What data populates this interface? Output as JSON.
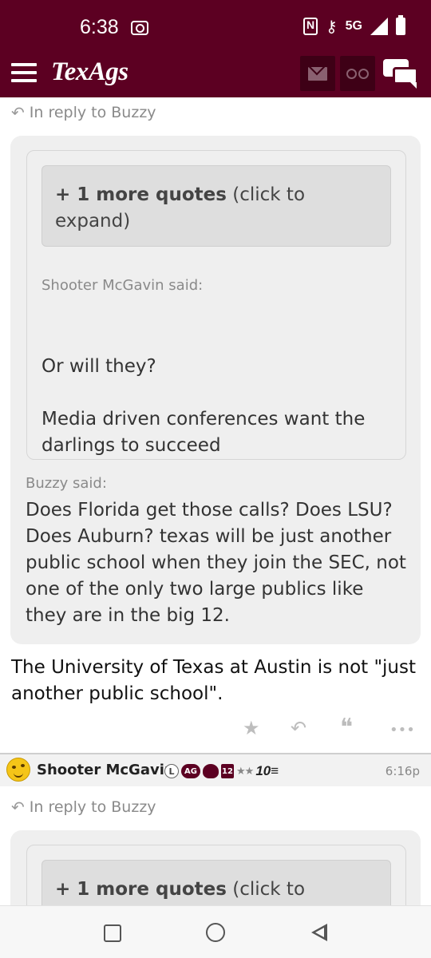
{
  "status_bar": {
    "time": "6:38",
    "network": "5G"
  },
  "header": {
    "logo": "TexAgs"
  },
  "post1": {
    "reply_to": "In reply to Buzzy",
    "more_quotes_bold": "+ 1 more quotes",
    "more_quotes_rest": " (click to expand)",
    "inner_quote": {
      "author": "Shooter McGavin said:",
      "line1": "Or will they?",
      "line2": "Media driven conferences want the darlings to succeed"
    },
    "outer_quote": {
      "author": "Buzzy said:",
      "text": "Does Florida get those calls? Does LSU? Does Auburn? texas will be just another public school when they join the SEC, not one of the only two large publics like they are in the big 12."
    },
    "body": "The University of Texas at Austin is not \"just another public school\"."
  },
  "post2": {
    "username": "Shooter McGavin",
    "badges": {
      "l": "L",
      "ag": "AG",
      "twelve": "12",
      "stars": "★★",
      "num": "10≡"
    },
    "time": "6:16p",
    "reply_to": "In reply to Buzzy",
    "more_quotes_bold": "+ 1 more quotes",
    "more_quotes_rest": " (click to"
  },
  "icons": {
    "action_star": "★",
    "action_reply": "↶",
    "action_quote": "❝",
    "action_more": "•••"
  }
}
